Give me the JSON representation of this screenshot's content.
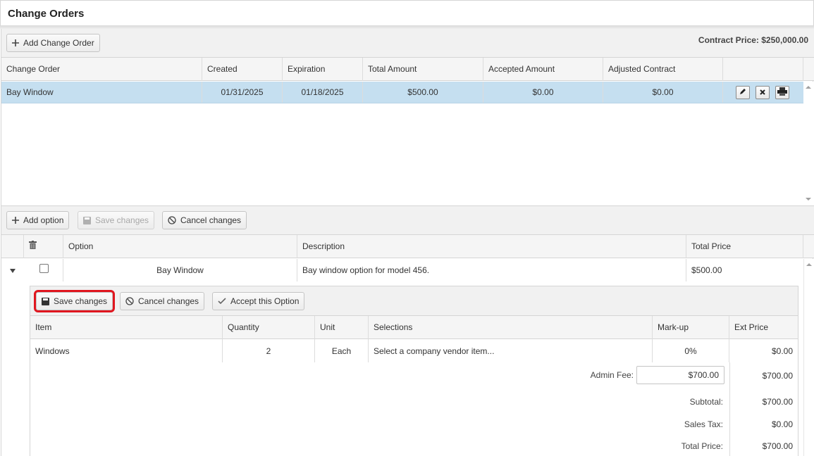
{
  "page": {
    "title": "Change Orders"
  },
  "top_toolbar": {
    "add_label": "Add Change Order",
    "contract_price": "Contract Price: $250,000.00"
  },
  "orders_table": {
    "headers": [
      "Change Order",
      "Created",
      "Expiration",
      "Total Amount",
      "Accepted Amount",
      "Adjusted Contract"
    ],
    "rows": [
      {
        "name": "Bay Window",
        "created": "01/31/2025",
        "expiration": "01/18/2025",
        "total": "$500.00",
        "accepted": "$0.00",
        "adjusted": "$0.00"
      }
    ],
    "selected_row_color": "#c5dff0"
  },
  "options_toolbar": {
    "add_label": "Add option",
    "save_label": "Save changes",
    "cancel_label": "Cancel changes"
  },
  "options_table": {
    "headers": [
      "Option",
      "Description",
      "Total Price"
    ],
    "rows": [
      {
        "option": "Bay Window",
        "description": "Bay window option for model 456.",
        "total": "$500.00",
        "checked": false
      }
    ]
  },
  "detail": {
    "toolbar": {
      "save_label": "Save changes",
      "cancel_label": "Cancel changes",
      "accept_label": "Accept this Option"
    },
    "headers": [
      "Item",
      "Quantity",
      "Unit",
      "Selections",
      "Mark-up",
      "Ext Price"
    ],
    "rows": [
      {
        "item": "Windows",
        "quantity": "2",
        "unit": "Each",
        "selection": "Select a company vendor item...",
        "markup": "0%",
        "ext": "$0.00"
      }
    ],
    "summary": {
      "admin_fee_label": "Admin Fee:",
      "admin_fee_input": "$700.00",
      "admin_fee_value": "$700.00",
      "subtotal_label": "Subtotal:",
      "subtotal_value": "$700.00",
      "tax_label": "Sales Tax:",
      "tax_value": "$0.00",
      "total_label": "Total Price:",
      "total_value": "$700.00"
    }
  },
  "colors": {
    "highlight": "#e0161f",
    "header_bg": "#f5f5f5",
    "toolbar_bg": "#f1f1f1"
  }
}
